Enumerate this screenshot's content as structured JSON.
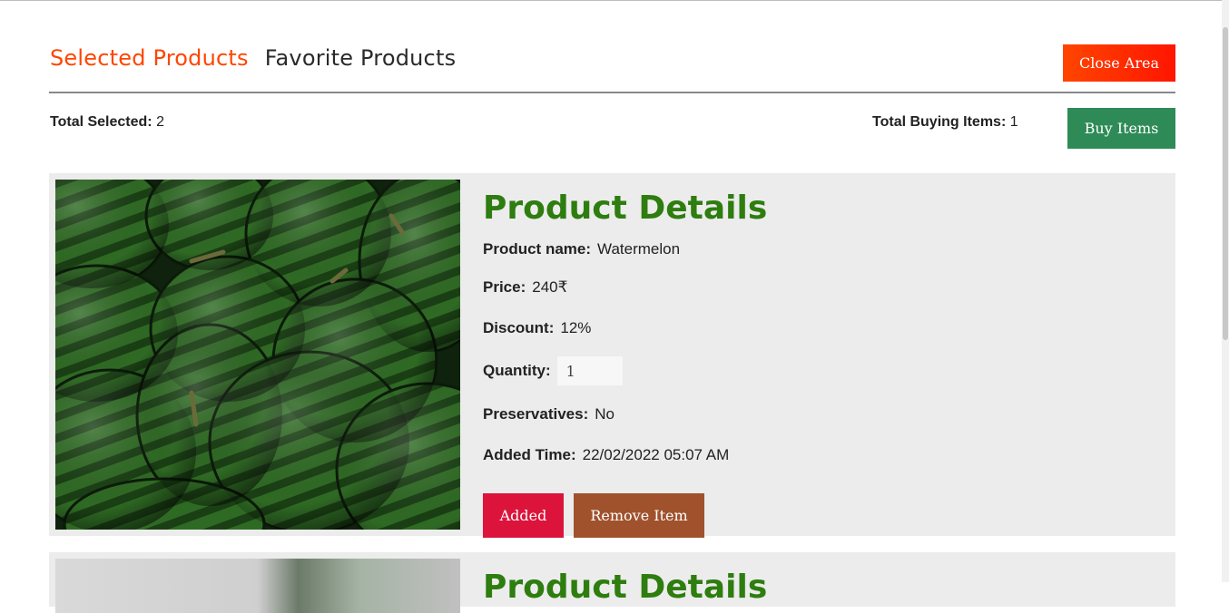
{
  "header": {
    "tabs": [
      {
        "label": "Selected Products",
        "active": true
      },
      {
        "label": "Favorite Products",
        "active": false
      }
    ],
    "close_label": "Close Area"
  },
  "summary": {
    "total_selected_label": "Total Selected:",
    "total_selected_value": "2",
    "total_buying_label": "Total Buying Items:",
    "total_buying_value": "1",
    "buy_label": "Buy Items"
  },
  "products": [
    {
      "title": "Product Details",
      "name_label": "Product name:",
      "name": "Watermelon",
      "price_label": "Price:",
      "price": "240₹",
      "discount_label": "Discount:",
      "discount": "12%",
      "quantity_label": "Quantity:",
      "quantity": "1",
      "preservatives_label": "Preservatives:",
      "preservatives": "No",
      "added_time_label": "Added Time:",
      "added_time": "22/02/2022 05:07 AM",
      "added_button": "Added",
      "remove_button": "Remove Item"
    },
    {
      "title": "Product Details"
    }
  ],
  "colors": {
    "active_tab": "#ff4500",
    "close_button": "#ff4500",
    "buy_button": "#2e8b57",
    "added_button": "#dc143c",
    "remove_button": "#a0522d",
    "details_title": "#2e7d0f",
    "card_bg": "#ececec"
  }
}
